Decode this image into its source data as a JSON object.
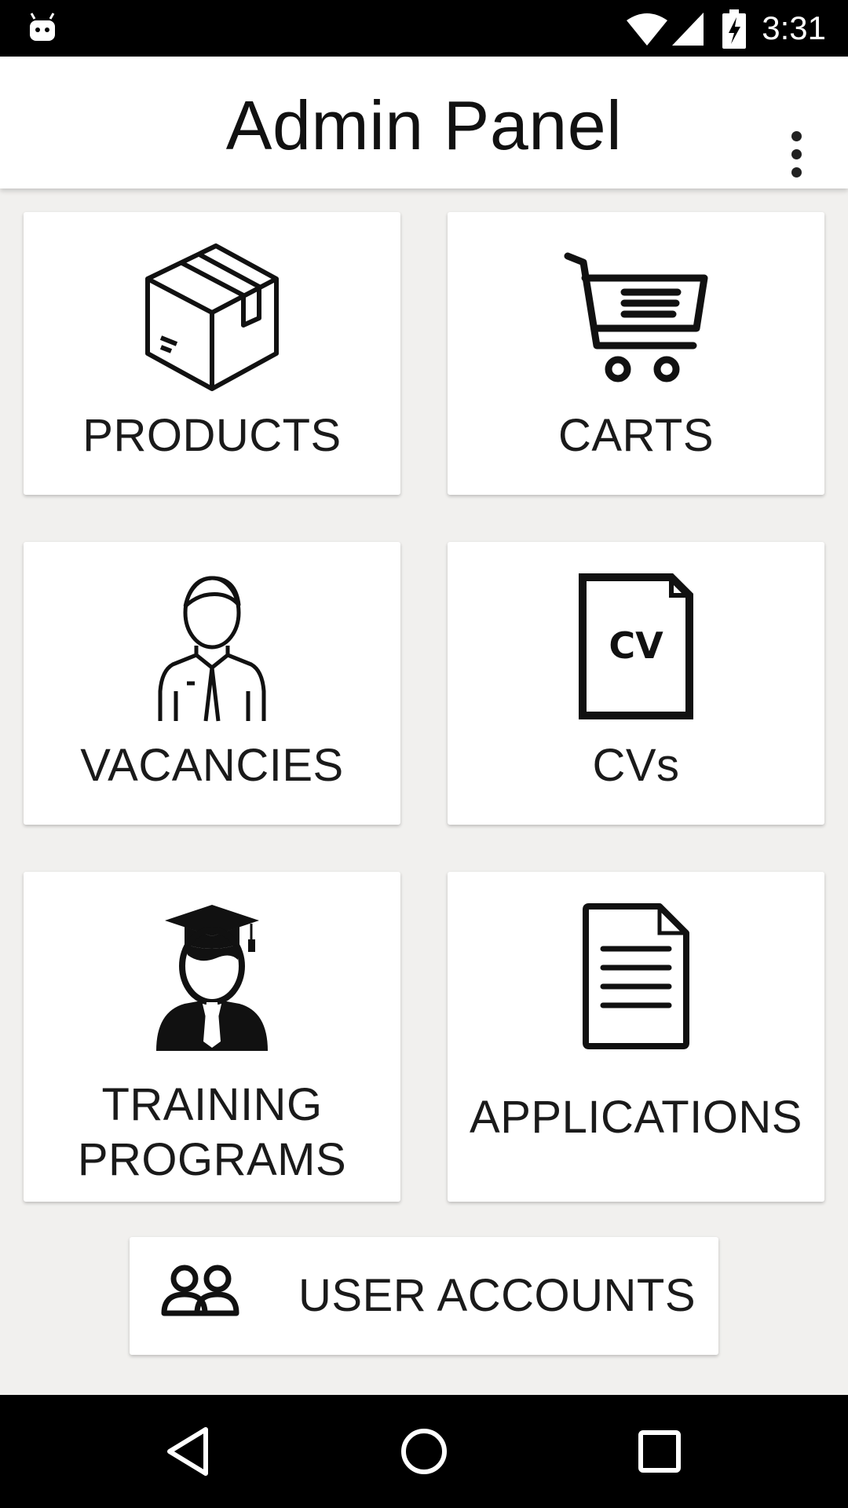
{
  "status_bar": {
    "time": "3:31",
    "icons": [
      "android-icon",
      "wifi-icon",
      "signal-icon",
      "battery-charging-icon"
    ]
  },
  "app_bar": {
    "title": "Admin Panel",
    "menu_icon": "more-vert-icon"
  },
  "cards": {
    "products": {
      "label": "PRODUCTS",
      "icon": "box-icon"
    },
    "carts": {
      "label": "CARTS",
      "icon": "cart-icon"
    },
    "vacancies": {
      "label": "VACANCIES",
      "icon": "employee-icon"
    },
    "cvs": {
      "label": "CVs",
      "icon": "cv-document-icon",
      "icon_text": "CV"
    },
    "training": {
      "label_line1": "TRAINING",
      "label_line2": "PROGRAMS",
      "icon": "graduate-icon"
    },
    "applications": {
      "label": "APPLICATIONS",
      "icon": "document-icon"
    }
  },
  "user_accounts": {
    "label": "USER ACCOUNTS",
    "icon": "users-icon"
  },
  "nav_bar": {
    "icons": [
      "back-icon",
      "home-icon",
      "recents-icon"
    ]
  },
  "colors": {
    "background": "#f1f0ee",
    "card": "#ffffff",
    "bars": "#000000"
  }
}
